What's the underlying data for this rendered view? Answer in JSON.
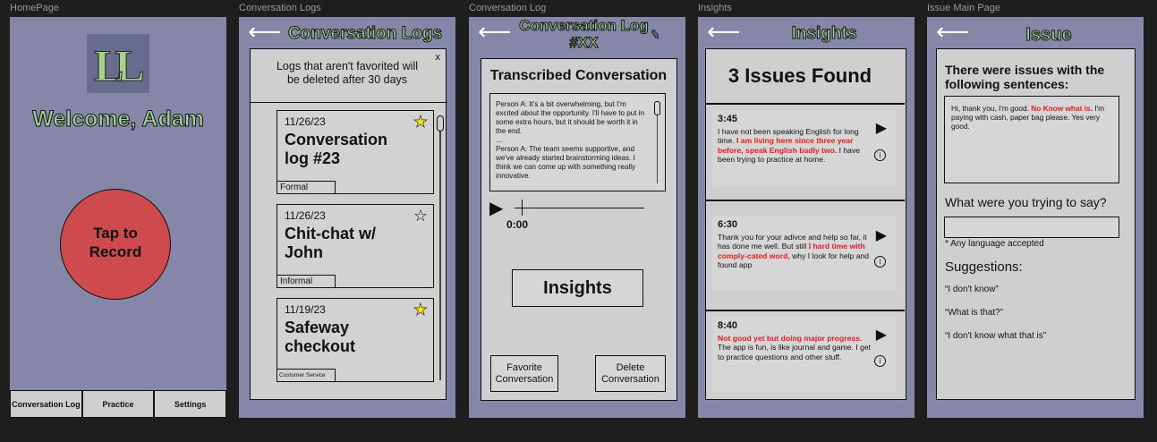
{
  "frames": {
    "home": {
      "label": "HomePage",
      "welcome": "Welcome, Adam",
      "logo_text": "LL",
      "record_line1": "Tap to",
      "record_line2": "Record",
      "nav": [
        "Conversation Log",
        "Practice",
        "Settings"
      ]
    },
    "logs": {
      "label": "Conversation Logs",
      "title": "Conversation Logs",
      "notice": "Logs that aren't favorited will be deleted after 30 days",
      "close": "x",
      "items": [
        {
          "date": "11/26/23",
          "title": "Conversation log #23",
          "tag": "Formal",
          "favorited": true
        },
        {
          "date": "11/26/23",
          "title": "Chit-chat w/ John",
          "tag": "Informal",
          "favorited": false
        },
        {
          "date": "11/19/23",
          "title": "Safeway checkout",
          "tag": "Customer Service",
          "favorited": true
        }
      ]
    },
    "log": {
      "label": "Conversation Log",
      "title_line1": "Conversation Log",
      "title_line2": "#XX",
      "transcribed_heading": "Transcribed Conversation",
      "transcript": "Person A: It's a bit overwhelming, but I'm excited about the opportunity. I'll have to put in some extra hours, but it should be worth it in the end.\n...\nPerson A: The team seems supportive, and we've already started brainstorming ideas. I think we can come up with something really innovative.",
      "time": "0:00",
      "insights_button": "Insights",
      "favorite_button": "Favorite Conversation",
      "delete_button": "Delete Conversation"
    },
    "insights": {
      "label": "Insights",
      "title": "Insights",
      "count_heading": "3 Issues Found",
      "issues": [
        {
          "time": "3:45",
          "before": "I have not been speaking English for long time. ",
          "error": "I am living here since three year before, speak English badly two.",
          "after": " I have been trying to practice at home."
        },
        {
          "time": "6:30",
          "before": "Thank you for your adivce and help so far, it has done me well. But still ",
          "error": "I hard time with comply-cated word,",
          "after": " why I look for help and found app"
        },
        {
          "time": "8:40",
          "before": "",
          "error": "Not good yet but doing major progress.",
          "after": " The app is fun, is like journal and game. I get to practice questions and other stuff."
        }
      ]
    },
    "issue": {
      "label": "Issue Main Page",
      "title": "Issue",
      "heading": "There were issues with the following sentences:",
      "sentence_before": "Hi, thank you, I'm good. ",
      "sentence_error": "No Know what is.",
      "sentence_after": " I'm paying with cash, paper bag please. Yes very good.",
      "question": "What were you trying to say?",
      "input_value": "",
      "note": "* Any language accepted",
      "suggestions_heading": "Suggestions:",
      "suggestions": [
        "“I don't know”",
        "“What is that?”",
        "“I don't know what that is”"
      ]
    }
  },
  "icons": {
    "back": "⟵",
    "star_filled": "★",
    "star_empty": "☆",
    "play": "▶",
    "info": "i",
    "pencil": "✎"
  },
  "colors": {
    "frame_bg": "#8586a8",
    "title_green": "#9fd38f",
    "record_red": "#cf4a4e",
    "star_yellow": "#f3e31b",
    "error_red": "#e01f1f"
  }
}
